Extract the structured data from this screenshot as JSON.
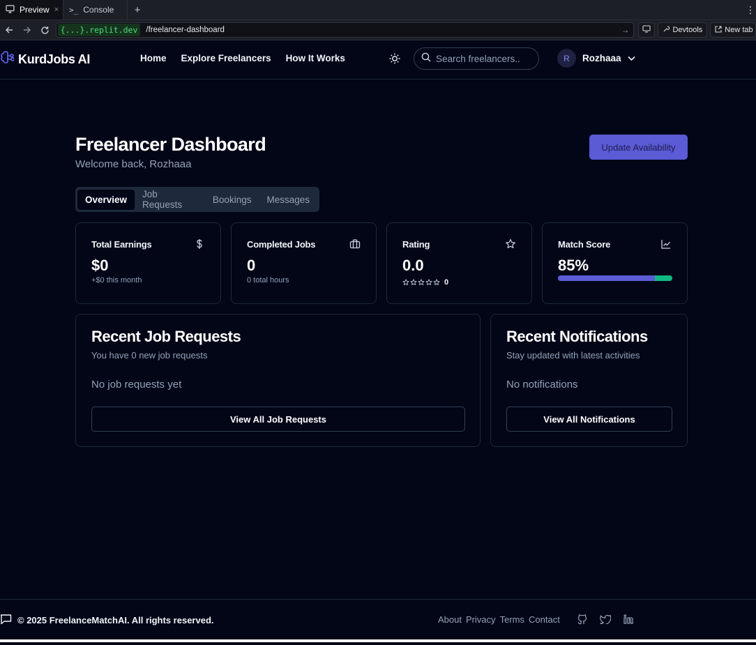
{
  "browser": {
    "tabs": [
      {
        "label": "Preview",
        "icon": "monitor-icon",
        "close": "×"
      },
      {
        "label": "Console",
        "icon": "terminal-icon"
      }
    ],
    "new_tab": "+",
    "address": {
      "domain": "{...}.replit.dev",
      "path": "/freelancer-dashboard"
    },
    "devtools_label": "Devtools",
    "newtab_label": "New tab"
  },
  "header": {
    "brand": "KurdJobs AI",
    "nav": [
      "Home",
      "Explore Freelancers",
      "How It Works"
    ],
    "search_placeholder": "Search freelancers..",
    "user": {
      "initial": "R",
      "name": "Rozhaaa"
    }
  },
  "dashboard": {
    "title": "Freelancer Dashboard",
    "welcome": "Welcome back, Rozhaaa",
    "update_button": "Update Availability",
    "tabs": [
      "Overview",
      "Job Requests",
      "Bookings",
      "Messages"
    ],
    "active_tab": "Overview",
    "stats": {
      "earnings": {
        "label": "Total Earnings",
        "value": "$0",
        "sub": "+$0 this month",
        "icon": "dollar-icon"
      },
      "jobs": {
        "label": "Completed Jobs",
        "value": "0",
        "sub": "0 total hours",
        "icon": "briefcase-icon"
      },
      "rating": {
        "label": "Rating",
        "value": "0.0",
        "review_count": "0",
        "stars": 0,
        "icon": "star-icon"
      },
      "match": {
        "label": "Match Score",
        "value": "85%",
        "progress": 0.85,
        "icon": "chart-icon"
      }
    },
    "job_requests": {
      "title": "Recent Job Requests",
      "subtitle": "You have 0 new job requests",
      "empty": "No job requests yet",
      "button": "View All Job Requests"
    },
    "notifications": {
      "title": "Recent Notifications",
      "subtitle": "Stay updated with latest activities",
      "empty": "No notifications",
      "button": "View All Notifications"
    }
  },
  "footer": {
    "copyright": "© 2025 FreelanceMatchAI. All rights reserved.",
    "links": [
      "About",
      "Privacy",
      "Terms",
      "Contact"
    ],
    "socials": [
      "github-icon",
      "twitter-icon",
      "linkedin-icon"
    ]
  },
  "colors": {
    "background": "#020617",
    "accent": "#5b5bd6",
    "progress_remainder": "#10b981",
    "border": "#1e293b"
  }
}
